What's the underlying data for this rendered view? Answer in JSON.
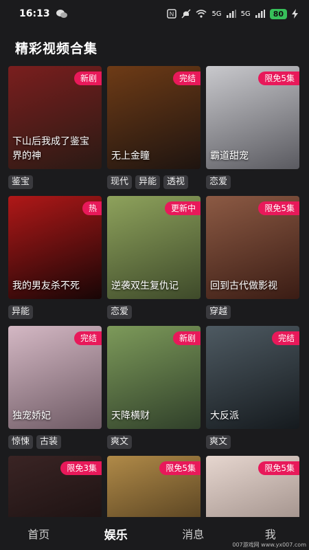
{
  "status": {
    "time": "16:13",
    "battery": "80",
    "net1": "5G",
    "net2": "5G"
  },
  "page": {
    "title": "精彩视频合集"
  },
  "cards": [
    {
      "title": "下山后我成了鉴宝界的神",
      "badge": "新剧",
      "tags": [
        "鉴宝"
      ],
      "colors": [
        "#7a1e1e",
        "#2a1a14"
      ]
    },
    {
      "title": "无上金瞳",
      "badge": "完结",
      "tags": [
        "现代",
        "异能",
        "透视"
      ],
      "colors": [
        "#6e3b16",
        "#1e1410"
      ]
    },
    {
      "title": "霸道甜宠",
      "badge": "限免5集",
      "tags": [
        "恋爱"
      ],
      "colors": [
        "#c9c9cd",
        "#5a5a60"
      ]
    },
    {
      "title": "我的男友杀不死",
      "badge": "热",
      "tags": [
        "异能"
      ],
      "colors": [
        "#b01818",
        "#180606"
      ]
    },
    {
      "title": "逆袭双生复仇记",
      "badge": "更新中",
      "tags": [
        "恋爱"
      ],
      "colors": [
        "#8ea25c",
        "#3e4a2a"
      ]
    },
    {
      "title": "回到古代做影视",
      "badge": "限免5集",
      "tags": [
        "穿越"
      ],
      "colors": [
        "#8c5a44",
        "#3a1c14"
      ]
    },
    {
      "title": "独宠娇妃",
      "badge": "完结",
      "tags": [
        "惊悚",
        "古装"
      ],
      "colors": [
        "#d4b8c4",
        "#6e5a64"
      ]
    },
    {
      "title": "天降横财",
      "badge": "新剧",
      "tags": [
        "爽文"
      ],
      "colors": [
        "#7d9a5a",
        "#30402a"
      ]
    },
    {
      "title": "大反派",
      "badge": "完结",
      "tags": [
        "爽文"
      ],
      "colors": [
        "#4e5a62",
        "#151a1e"
      ]
    },
    {
      "title": "",
      "badge": "限免3集",
      "tags": [],
      "colors": [
        "#3a2424",
        "#120c0c"
      ]
    },
    {
      "title": "",
      "badge": "限免5集",
      "tags": [],
      "colors": [
        "#b08a48",
        "#3a2a14"
      ]
    },
    {
      "title": "",
      "badge": "限免5集",
      "tags": [],
      "colors": [
        "#e6d6cf",
        "#8a7a74"
      ]
    }
  ],
  "nav": {
    "home": "首页",
    "ent": "娱乐",
    "msg": "消息",
    "me": "我"
  },
  "watermark": "007游戏网 www.yx007.com"
}
